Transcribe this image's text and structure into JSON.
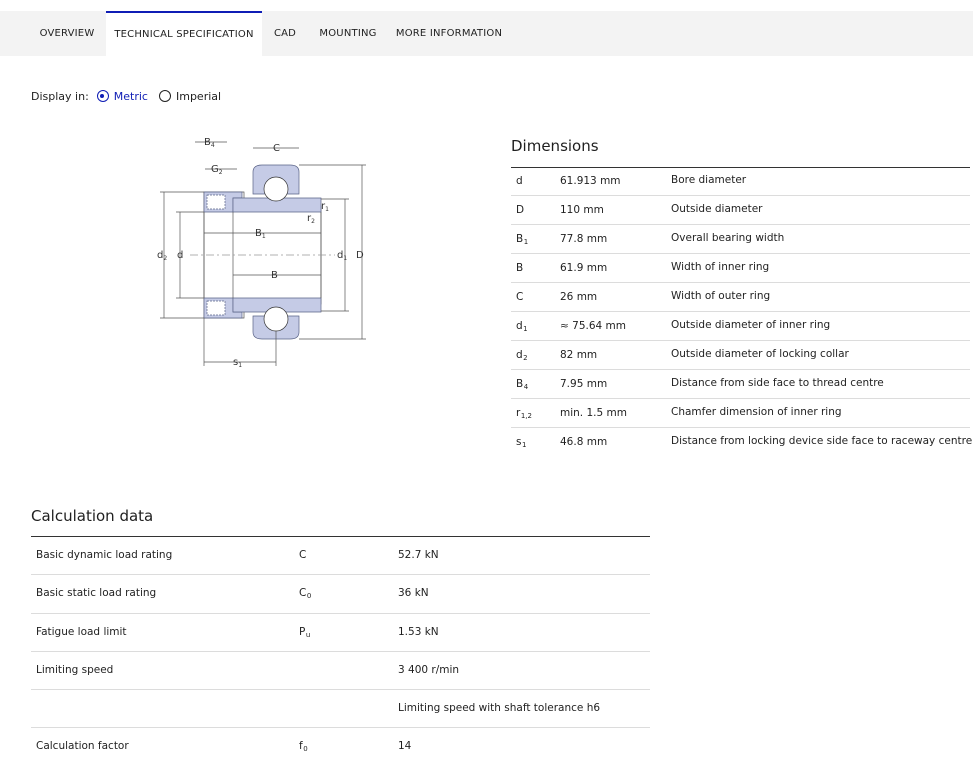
{
  "tabs": [
    {
      "label": "OVERVIEW",
      "active": false
    },
    {
      "label": "TECHNICAL SPECIFICATION",
      "active": true
    },
    {
      "label": "CAD",
      "active": false
    },
    {
      "label": "MOUNTING",
      "active": false
    },
    {
      "label": "MORE INFORMATION",
      "active": false
    }
  ],
  "display": {
    "label": "Display in:",
    "options": [
      {
        "label": "Metric",
        "checked": true
      },
      {
        "label": "Imperial",
        "checked": false
      }
    ]
  },
  "drawing_labels": {
    "B4": "B",
    "B4_sub": "4",
    "G2": "G",
    "G2_sub": "2",
    "C": "C",
    "r1": "r",
    "r1_sub": "1",
    "r2": "r",
    "r2_sub": "2",
    "B1": "B",
    "B1_sub": "1",
    "B": "B",
    "d2": "d",
    "d2_sub": "2",
    "d": "d",
    "d1": "d",
    "d1_sub": "1",
    "D": "D",
    "s1": "s",
    "s1_sub": "1"
  },
  "dimensions": {
    "title": "Dimensions",
    "rows": [
      {
        "sym": "d",
        "sub": "",
        "value": "61.913 mm",
        "desc": "Bore diameter"
      },
      {
        "sym": "D",
        "sub": "",
        "value": "110 mm",
        "desc": "Outside diameter"
      },
      {
        "sym": "B",
        "sub": "1",
        "value": "77.8 mm",
        "desc": "Overall bearing width"
      },
      {
        "sym": "B",
        "sub": "",
        "value": "61.9 mm",
        "desc": "Width of inner ring"
      },
      {
        "sym": "C",
        "sub": "",
        "value": "26 mm",
        "desc": "Width of outer ring"
      },
      {
        "sym": "d",
        "sub": "1",
        "value": "≈ 75.64 mm",
        "desc": "Outside diameter of inner ring"
      },
      {
        "sym": "d",
        "sub": "2",
        "value": "82 mm",
        "desc": "Outside diameter of locking collar"
      },
      {
        "sym": "B",
        "sub": "4",
        "value": "7.95 mm",
        "desc": "Distance from side face to thread centre"
      },
      {
        "sym": "r",
        "sub": "1,2",
        "value": "min. 1.5 mm",
        "desc": "Chamfer dimension of inner ring"
      },
      {
        "sym": "s",
        "sub": "1",
        "value": "46.8 mm",
        "desc": "Distance from locking device side face to raceway centre"
      }
    ]
  },
  "calculation": {
    "title": "Calculation data",
    "rows": [
      {
        "name": "Basic dynamic load rating",
        "sym": "C",
        "sub": "",
        "value": "52.7 kN"
      },
      {
        "name": "Basic static load rating",
        "sym": "C",
        "sub": "0",
        "value": "36 kN"
      },
      {
        "name": "Fatigue load limit",
        "sym": "P",
        "sub": "u",
        "value": "1.53 kN"
      },
      {
        "name": "Limiting speed",
        "sym": "",
        "sub": "",
        "value": "3 400 r/min"
      },
      {
        "name": "",
        "sym": "",
        "sub": "",
        "value": "Limiting speed with shaft tolerance h6"
      },
      {
        "name": "Calculation factor",
        "sym": "f",
        "sub": "0",
        "value": "14"
      }
    ]
  },
  "colors": {
    "accent": "#0f1db5",
    "tabbar_bg": "#f3f3f3",
    "bearing_fill": "#c5cbe6",
    "bearing_stroke": "#5a6387"
  }
}
